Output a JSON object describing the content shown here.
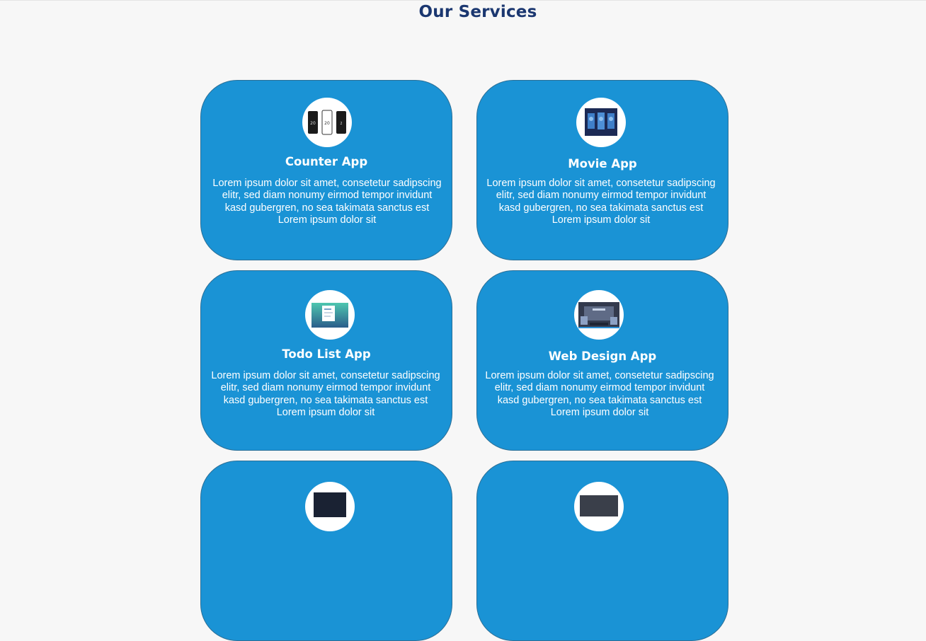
{
  "page": {
    "title": "Our Services"
  },
  "services": [
    {
      "title": "Counter App",
      "description": "Lorem ipsum dolor sit amet, consetetur sadipscing elitr, sed diam nonumy eirmod tempor invidunt kasd gubergren, no sea takimata sanctus est Lorem ipsum dolor sit",
      "icon": "counter-app-thumbnail-icon"
    },
    {
      "title": "Movie App",
      "description": "Lorem ipsum dolor sit amet, consetetur sadipscing elitr, sed diam nonumy eirmod tempor invidunt kasd gubergren, no sea takimata sanctus est Lorem ipsum dolor sit",
      "icon": "movie-app-thumbnail-icon"
    },
    {
      "title": "Todo List App",
      "description": "Lorem ipsum dolor sit amet, consetetur sadipscing elitr, sed diam nonumy eirmod tempor invidunt kasd gubergren, no sea takimata sanctus est Lorem ipsum dolor sit",
      "icon": "todo-app-thumbnail-icon"
    },
    {
      "title": "Web Design App",
      "description": "Lorem ipsum dolor sit amet, consetetur sadipscing elitr, sed diam nonumy eirmod tempor invidunt kasd gubergren, no sea takimata sanctus est Lorem ipsum dolor sit",
      "icon": "web-design-app-thumbnail-icon"
    },
    {
      "title": "",
      "description": "",
      "icon": "app-thumbnail-icon"
    },
    {
      "title": "",
      "description": "",
      "icon": "app-thumbnail-icon"
    }
  ],
  "colors": {
    "background": "#f7f7f7",
    "title": "#1b3770",
    "card": "#1a93d5",
    "card_border": "#2a6f97",
    "text": "#ffffff"
  }
}
